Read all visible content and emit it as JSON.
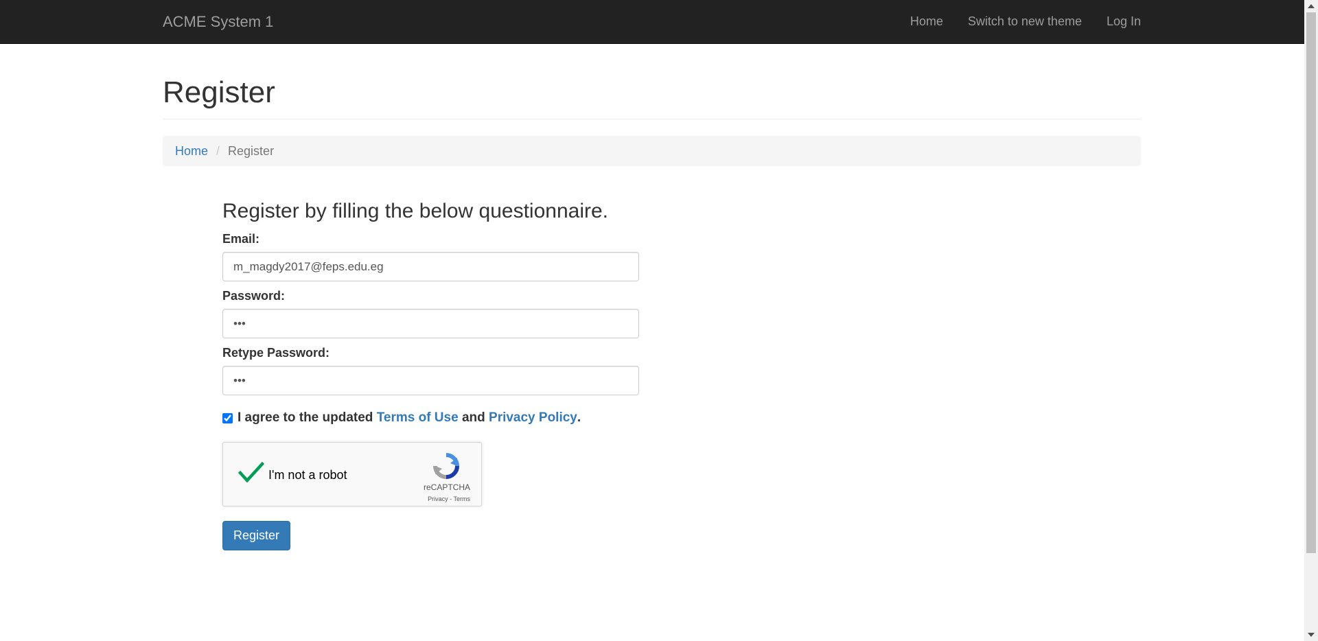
{
  "navbar": {
    "brand": "ACME System 1",
    "links": [
      "Home",
      "Switch to new theme",
      "Log In"
    ]
  },
  "page": {
    "title": "Register"
  },
  "breadcrumb": {
    "home": "Home",
    "separator": "/",
    "current": "Register"
  },
  "form": {
    "heading": "Register by filling the below questionnaire.",
    "email_label": "Email:",
    "email_value": "m_magdy2017@feps.edu.eg",
    "password_label": "Password:",
    "password_value": "•••",
    "retype_label": "Retype Password:",
    "retype_value": "•••",
    "agree_checked": true,
    "agree_prefix": "I agree to the updated ",
    "terms_link": "Terms of Use",
    "agree_mid": " and ",
    "privacy_link": "Privacy Policy",
    "agree_suffix": ".",
    "submit_label": "Register"
  },
  "captcha": {
    "label": "I'm not a robot",
    "brand": "reCAPTCHA",
    "privacy": "Privacy",
    "dot": " - ",
    "terms": "Terms",
    "verified": true
  },
  "colors": {
    "navbar_bg": "#222222",
    "link": "#337ab7",
    "button": "#337ab7",
    "check_green": "#009e55"
  }
}
